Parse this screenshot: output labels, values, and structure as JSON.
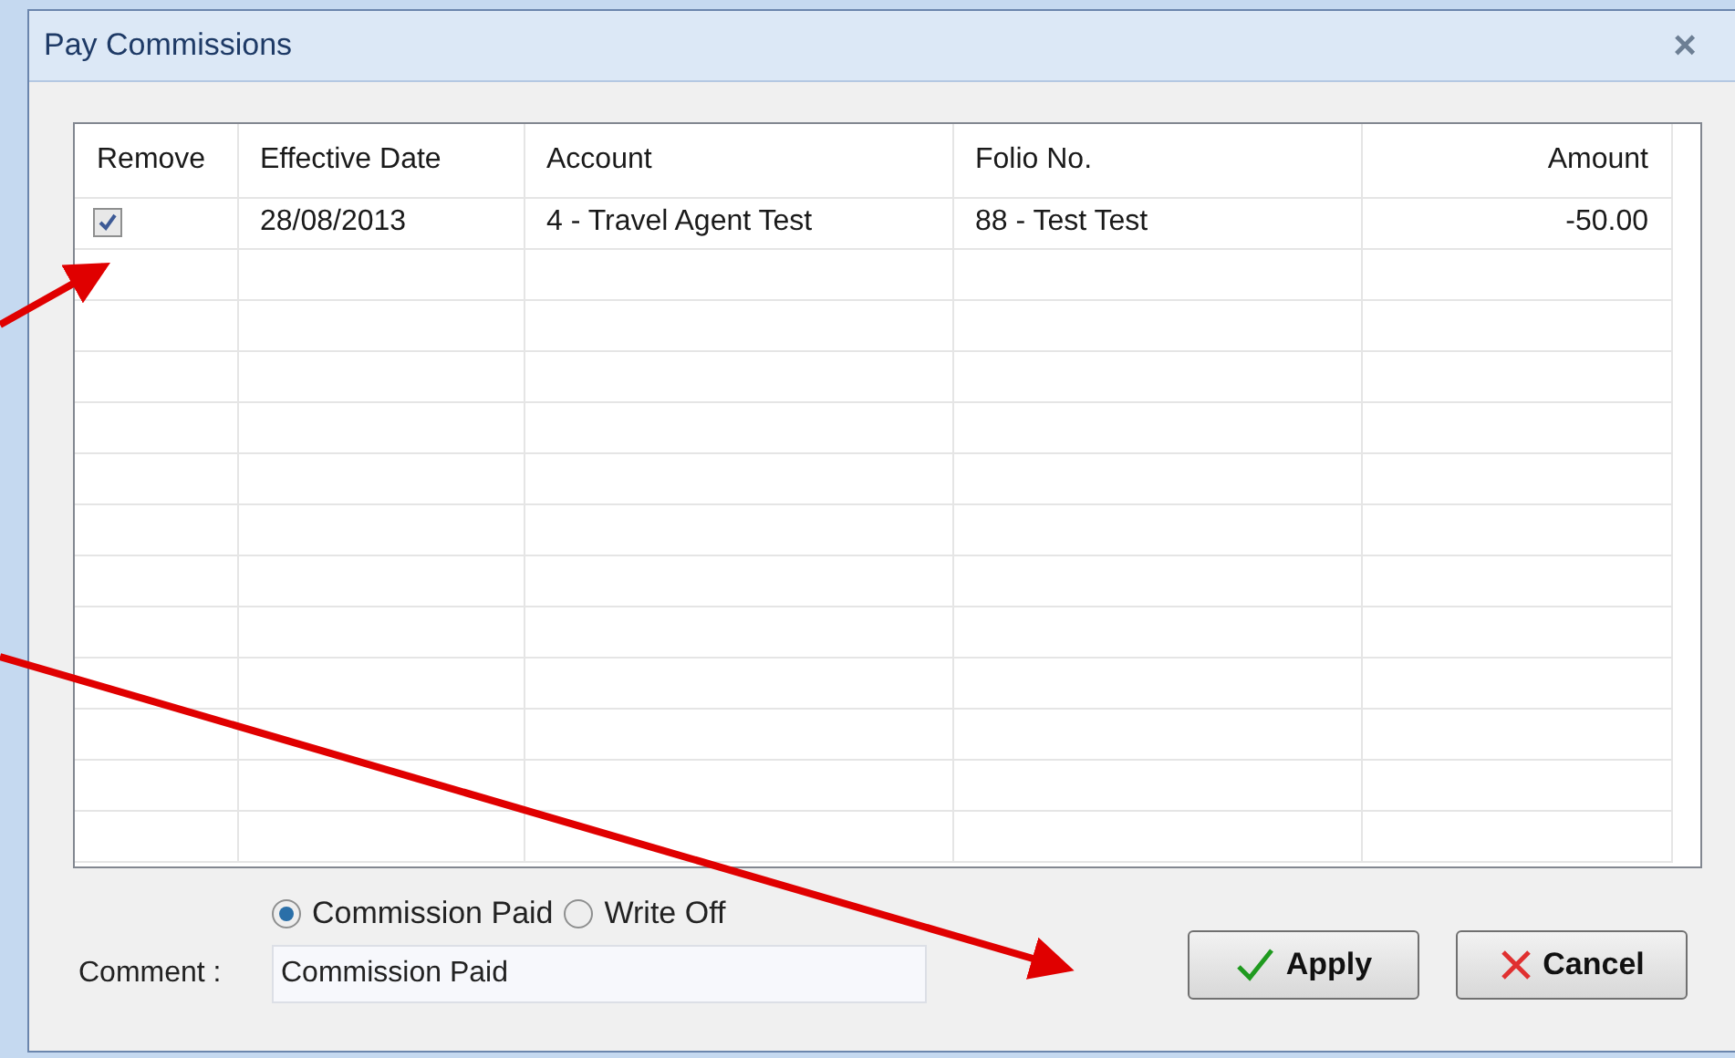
{
  "window": {
    "title": "Pay Commissions",
    "close": "×"
  },
  "table": {
    "columns": [
      "Remove",
      "Effective Date",
      "Account",
      "Folio No.",
      "Amount"
    ],
    "rows": [
      {
        "remove": true,
        "effective_date": "28/08/2013",
        "account": "4 - Travel Agent Test",
        "folio_no": "88 - Test Test",
        "amount": "-50.00"
      }
    ]
  },
  "payment_type": [
    {
      "label": "Commission Paid",
      "selected": true
    },
    {
      "label": "Write Off",
      "selected": false
    }
  ],
  "comment": {
    "label": "Comment :",
    "value": "Commission Paid"
  },
  "buttons": [
    {
      "kind": "apply",
      "label": "Apply"
    },
    {
      "kind": "cancel",
      "label": "Cancel"
    }
  ]
}
